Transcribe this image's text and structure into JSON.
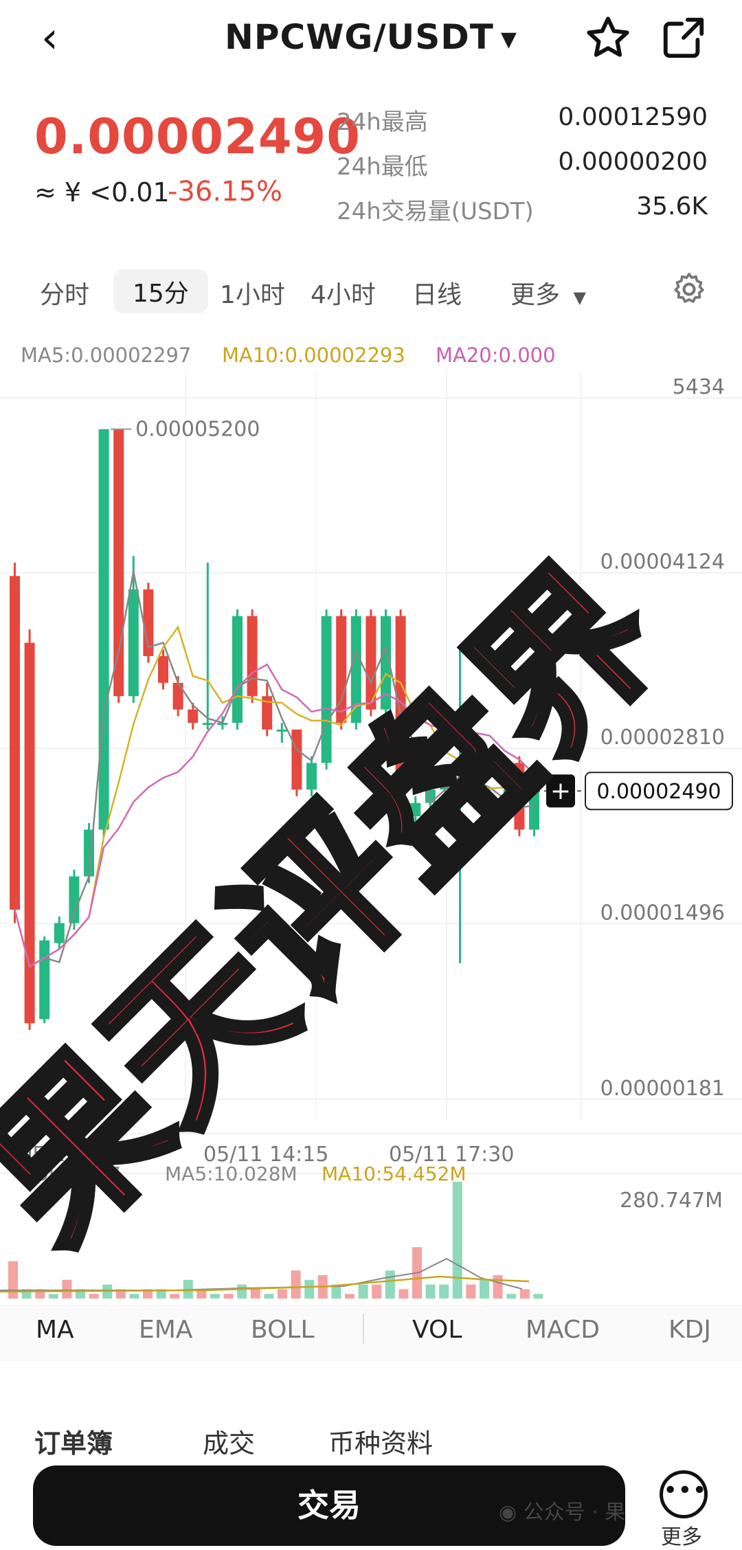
{
  "header": {
    "title": "NPCWG/USDT",
    "back_icon": "chevron-left-icon",
    "caret_icon": "caret-down-icon",
    "star_icon": "star-icon",
    "share_icon": "share-icon"
  },
  "price": {
    "last": "0.00002490",
    "cny": "≈ ¥ <0.01",
    "change": "-36.15%",
    "stats": [
      {
        "label": "24h最高",
        "value": "0.00012590"
      },
      {
        "label": "24h最低",
        "value": "0.00000200"
      },
      {
        "label": "24h交易量(USDT)",
        "value": "35.6K"
      }
    ]
  },
  "periods": {
    "items": [
      "分时",
      "15分",
      "1小时",
      "4小时",
      "日线",
      "更多"
    ],
    "active": "15分",
    "more_caret_icon": "caret-down-icon",
    "settings_icon": "gear-icon"
  },
  "ma": {
    "ma5": "MA5:0.00002297",
    "ma10": "MA10:0.00002293",
    "ma20": "MA20:0.000",
    "colors": {
      "ma5": "#888888",
      "ma10": "#d4b326",
      "ma20": "#d16ab8"
    }
  },
  "chart_data": {
    "type": "candlestick",
    "y_labels": [
      "5434",
      "0.00004124",
      "0.00002810",
      "0.00001496",
      "0.00000181"
    ],
    "high_marker": "0.00005200",
    "current_price_tag": "0.00002490",
    "x_labels": [
      "05/11",
      "05/11 14:15",
      "05/11 17:30"
    ],
    "colors": {
      "up": "#25b882",
      "down": "#e5483e"
    },
    "candles": [
      {
        "o": 4.1e-05,
        "c": 1.6e-05,
        "h": 4.2e-05,
        "l": 1.5e-05
      },
      {
        "o": 3.6e-05,
        "c": 7.5e-06,
        "h": 3.7e-05,
        "l": 7e-06
      },
      {
        "o": 7.8e-06,
        "c": 1.37e-05,
        "h": 1.4e-05,
        "l": 7.5e-06
      },
      {
        "o": 1.35e-05,
        "c": 1.5e-05,
        "h": 1.55e-05,
        "l": 1.3e-05
      },
      {
        "o": 1.5e-05,
        "c": 1.85e-05,
        "h": 1.9e-05,
        "l": 1.45e-05
      },
      {
        "o": 1.85e-05,
        "c": 2.2e-05,
        "h": 2.25e-05,
        "l": 1.8e-05
      },
      {
        "o": 2.2e-05,
        "c": 5.2e-05,
        "h": 5.2e-05,
        "l": 2.15e-05
      },
      {
        "o": 5.2e-05,
        "c": 3.2e-05,
        "h": 5.2e-05,
        "l": 3.15e-05
      },
      {
        "o": 3.2e-05,
        "c": 4e-05,
        "h": 4.25e-05,
        "l": 3.15e-05
      },
      {
        "o": 4e-05,
        "c": 3.5e-05,
        "h": 4.05e-05,
        "l": 3.45e-05
      },
      {
        "o": 3.5e-05,
        "c": 3.3e-05,
        "h": 3.55e-05,
        "l": 3.25e-05
      },
      {
        "o": 3.3e-05,
        "c": 3.1e-05,
        "h": 3.35e-05,
        "l": 3.05e-05
      },
      {
        "o": 3.1e-05,
        "c": 3e-05,
        "h": 3.15e-05,
        "l": 2.95e-05
      },
      {
        "o": 3e-05,
        "c": 3e-05,
        "h": 4.2e-05,
        "l": 2.95e-05
      },
      {
        "o": 3e-05,
        "c": 3e-05,
        "h": 3.05e-05,
        "l": 2.95e-05
      },
      {
        "o": 3e-05,
        "c": 3.8e-05,
        "h": 3.85e-05,
        "l": 2.95e-05
      },
      {
        "o": 3.8e-05,
        "c": 3.2e-05,
        "h": 3.85e-05,
        "l": 3.15e-05
      },
      {
        "o": 3.2e-05,
        "c": 2.95e-05,
        "h": 3.3e-05,
        "l": 2.9e-05
      },
      {
        "o": 2.95e-05,
        "c": 2.95e-05,
        "h": 3e-05,
        "l": 2.85e-05
      },
      {
        "o": 2.95e-05,
        "c": 2.5e-05,
        "h": 2.95e-05,
        "l": 2.45e-05
      },
      {
        "o": 2.5e-05,
        "c": 2.7e-05,
        "h": 2.75e-05,
        "l": 2.45e-05
      },
      {
        "o": 2.7e-05,
        "c": 3.8e-05,
        "h": 3.85e-05,
        "l": 2.65e-05
      },
      {
        "o": 3.8e-05,
        "c": 3e-05,
        "h": 3.85e-05,
        "l": 2.95e-05
      },
      {
        "o": 3e-05,
        "c": 3.8e-05,
        "h": 3.85e-05,
        "l": 2.95e-05
      },
      {
        "o": 3.8e-05,
        "c": 3.1e-05,
        "h": 3.85e-05,
        "l": 3.05e-05
      },
      {
        "o": 3.1e-05,
        "c": 3.8e-05,
        "h": 3.85e-05,
        "l": 3.05e-05
      },
      {
        "o": 3.8e-05,
        "c": 2.3e-05,
        "h": 3.85e-05,
        "l": 2.25e-05
      },
      {
        "o": 2.3e-05,
        "c": 2.4e-05,
        "h": 2.45e-05,
        "l": 2.2e-05
      },
      {
        "o": 2.4e-05,
        "c": 2.5e-05,
        "h": 2.55e-05,
        "l": 2.35e-05
      },
      {
        "o": 2.5e-05,
        "c": 2.6e-05,
        "h": 2.65e-05,
        "l": 2.45e-05
      },
      {
        "o": 2.6e-05,
        "c": 2.7e-05,
        "h": 3.55e-05,
        "l": 1.2e-05
      },
      {
        "o": 2.7e-05,
        "c": 2.4e-05,
        "h": 2.75e-05,
        "l": 2.35e-05
      },
      {
        "o": 2.4e-05,
        "c": 2.45e-05,
        "h": 2.5e-05,
        "l": 2.35e-05
      },
      {
        "o": 2.45e-05,
        "c": 2.45e-05,
        "h": 2.5e-05,
        "l": 2.4e-05
      },
      {
        "o": 2.7e-05,
        "c": 2.2e-05,
        "h": 2.75e-05,
        "l": 2.15e-05
      },
      {
        "o": 2.2e-05,
        "c": 2.49e-05,
        "h": 2.6e-05,
        "l": 2.15e-05
      }
    ],
    "ylim": [
      1.8e-06,
      5.43e-05
    ]
  },
  "volume": {
    "vol": "VOL:18.27",
    "ma5": "MA5:10.028M",
    "ma10": "MA10:54.452M",
    "max_label": "280.747M",
    "bars": [
      8,
      2,
      2,
      1,
      4,
      2,
      1,
      3,
      2,
      1,
      2,
      2,
      1,
      4,
      2,
      1,
      1,
      3,
      2,
      1,
      2,
      6,
      4,
      5,
      3,
      1,
      3,
      3,
      6,
      2,
      11,
      3,
      3,
      25,
      3,
      4,
      5,
      1,
      2,
      1
    ],
    "bar_up": [
      false,
      true,
      false,
      true,
      false,
      true,
      false,
      true,
      false,
      true,
      false,
      true,
      false,
      true,
      false,
      true,
      false,
      true,
      false,
      true,
      false,
      false,
      true,
      false,
      true,
      false,
      true,
      false,
      true,
      false,
      false,
      true,
      true,
      true,
      false,
      true,
      false,
      true,
      false,
      true
    ]
  },
  "indicators": {
    "items": [
      "MA",
      "EMA",
      "BOLL",
      "VOL",
      "MACD",
      "KDJ"
    ],
    "active": [
      "MA",
      "VOL"
    ]
  },
  "bottom": {
    "subtabs": [
      "订单簿",
      "成交",
      "币种资料"
    ],
    "trade": "交易",
    "more_icon": "more-dots-icon",
    "more": "更多",
    "watermark": "公众号 · 果"
  },
  "stamp": {
    "text": "果天评盘界"
  }
}
